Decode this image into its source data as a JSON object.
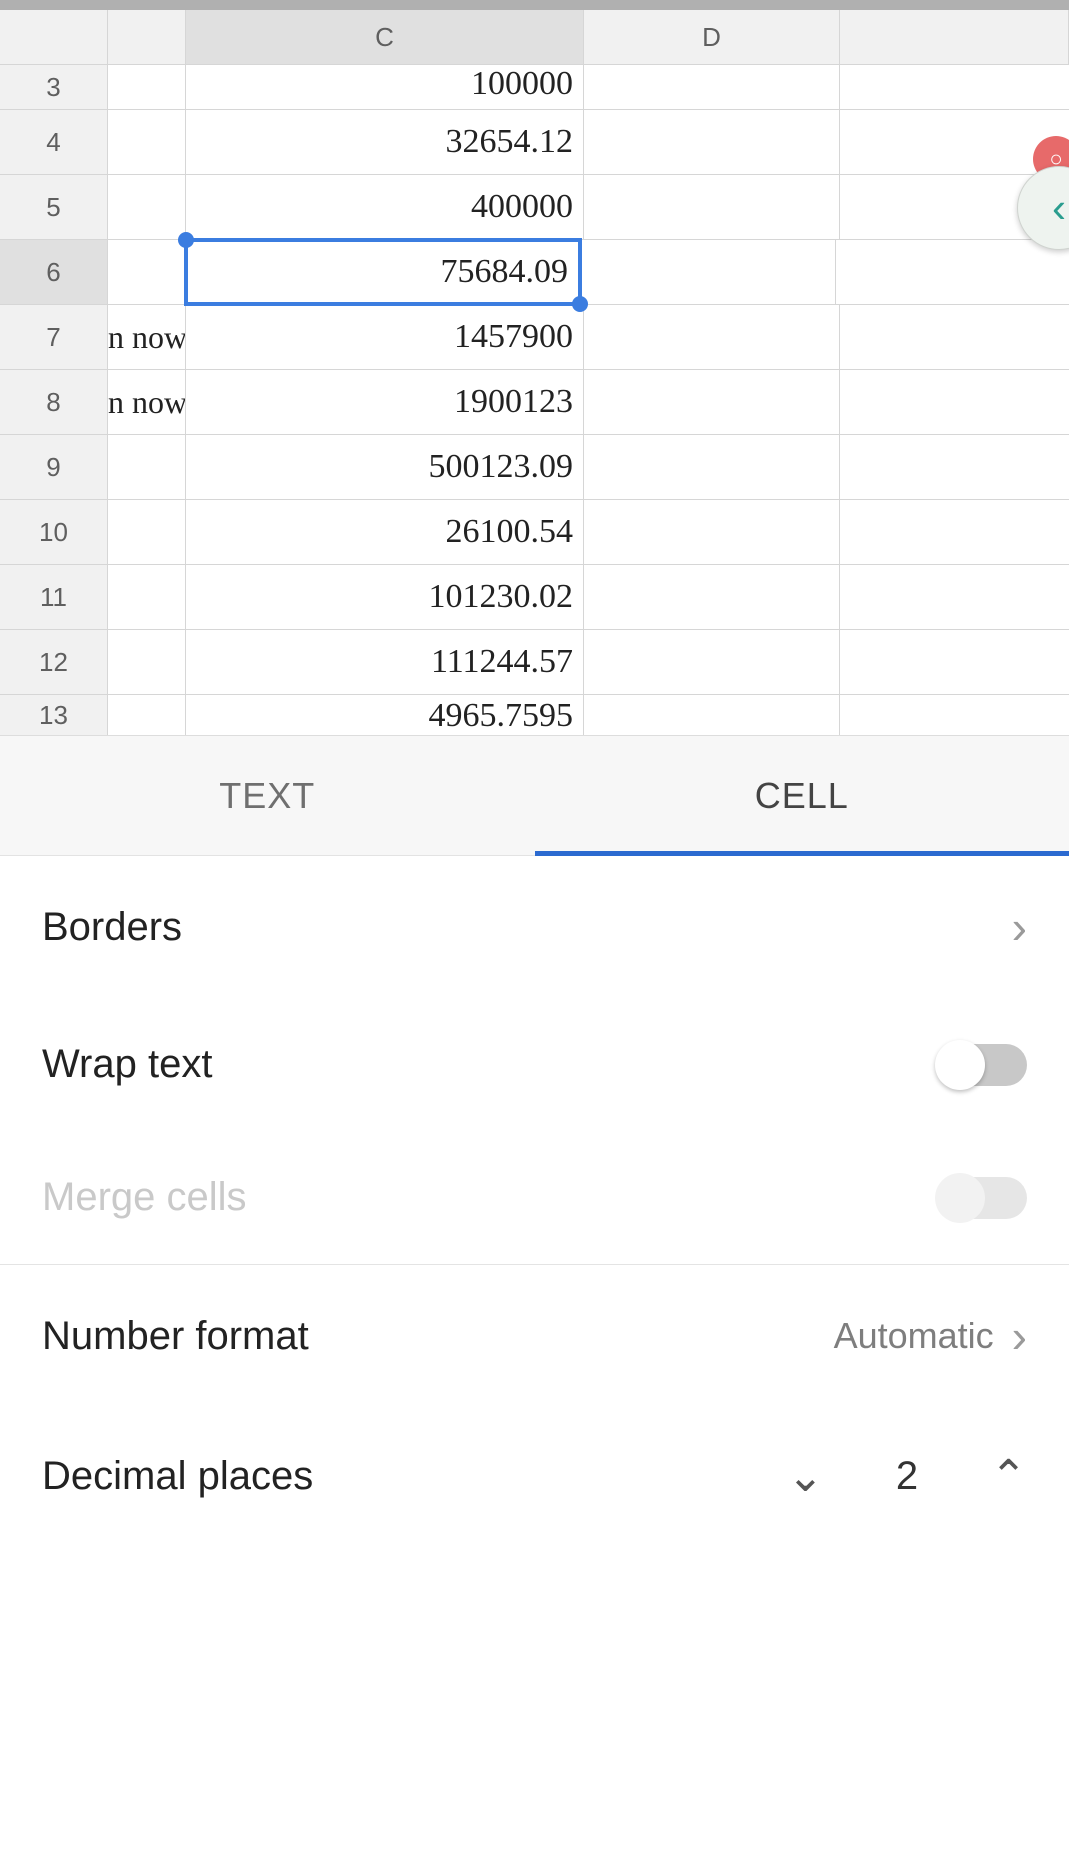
{
  "grid": {
    "columns": {
      "c_label": "C",
      "d_label": "D"
    },
    "selected_cell": "C6",
    "rows": [
      {
        "n": "3",
        "b": "",
        "c": "100000"
      },
      {
        "n": "4",
        "b": "",
        "c": "32654.12"
      },
      {
        "n": "5",
        "b": "",
        "c": "400000"
      },
      {
        "n": "6",
        "b": "",
        "c": "75684.09",
        "selected": true
      },
      {
        "n": "7",
        "b": "n now",
        "c": "1457900"
      },
      {
        "n": "8",
        "b": "n now",
        "c": "1900123"
      },
      {
        "n": "9",
        "b": "",
        "c": "500123.09"
      },
      {
        "n": "10",
        "b": "",
        "c": "26100.54"
      },
      {
        "n": "11",
        "b": "",
        "c": "101230.02"
      },
      {
        "n": "12",
        "b": "",
        "c": "111244.57"
      },
      {
        "n": "13",
        "b": "",
        "c": "4965.7595"
      }
    ]
  },
  "panel": {
    "tabs": {
      "text": "TEXT",
      "cell": "CELL"
    },
    "active_tab": "CELL",
    "borders_label": "Borders",
    "wrap_label": "Wrap text",
    "wrap_on": false,
    "merge_label": "Merge cells",
    "merge_enabled": false,
    "nf_label": "Number format",
    "nf_value": "Automatic",
    "dec_label": "Decimal places",
    "dec_value": "2"
  }
}
